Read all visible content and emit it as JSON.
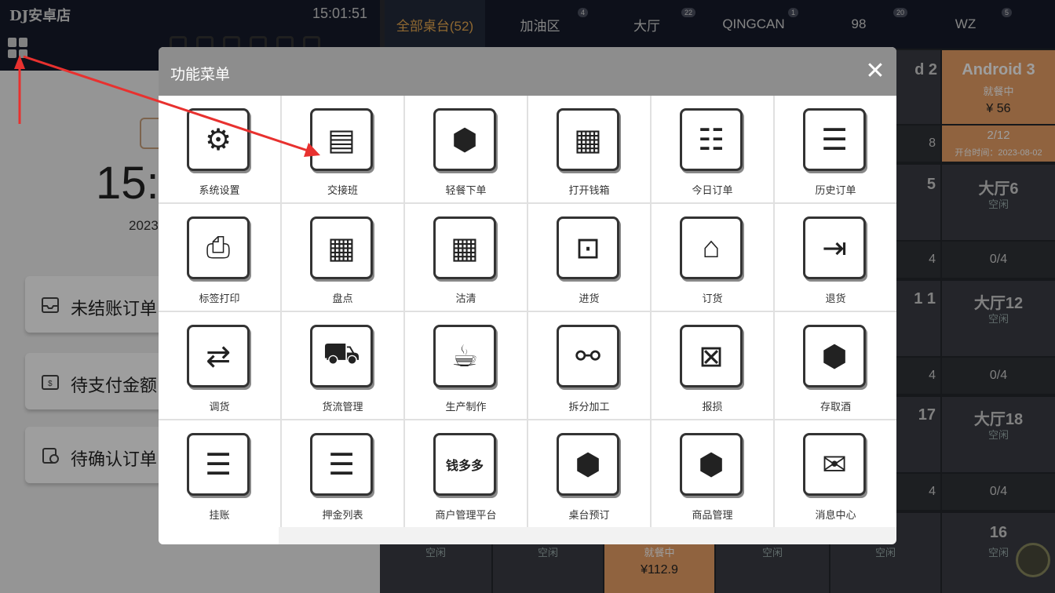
{
  "store_name": "DJ安卓店",
  "clock": "15:01:51",
  "big_time": "15:",
  "big_date": "2023",
  "tabs": [
    {
      "label": "全部桌台(52)",
      "count": ""
    },
    {
      "label": "加油区",
      "count": "4"
    },
    {
      "label": "大厅",
      "count": "22"
    },
    {
      "label": "QINGCAN",
      "count": "1"
    },
    {
      "label": "98",
      "count": "20"
    },
    {
      "label": "WZ",
      "count": "5"
    }
  ],
  "left_cards": [
    {
      "label": "未结账订单",
      "icon": "inbox-icon"
    },
    {
      "label": "待支付金额",
      "icon": "wallet-icon"
    },
    {
      "label": "待确认订单",
      "icon": "clipboard-check-icon"
    }
  ],
  "tables": {
    "partial_d2": "d 2",
    "partial_8": "8",
    "partial_5": "5",
    "partial_4a": "4",
    "partial_11": "1 1",
    "partial_4b": "4",
    "partial_17": "17",
    "partial_4c": "4",
    "android3": {
      "name": "Android 3",
      "status": "就餐中",
      "amount": "¥ 56",
      "guests": "2/12",
      "open_time": "开台时间：2023-08-02"
    },
    "hall6": {
      "name": "大厅6",
      "status": "空闲",
      "guests": "0/4"
    },
    "hall12": {
      "name": "大厅12",
      "status": "空闲",
      "guests": "0/4"
    },
    "hall18": {
      "name": "大厅18",
      "status": "空闲",
      "guests": "0/4"
    },
    "t16": {
      "name": "16",
      "status": "空闲"
    },
    "bottom_row": [
      "空闲",
      "空闲",
      "就餐中",
      "空闲",
      "空闲"
    ],
    "bottom_amount": "¥112.9"
  },
  "modal": {
    "title": "功能菜单",
    "close": "✕",
    "items": [
      {
        "label": "系统设置",
        "icon": "gear-icon",
        "glyph": "⚙"
      },
      {
        "label": "交接班",
        "icon": "id-card-icon",
        "glyph": "▤"
      },
      {
        "label": "轻餐下单",
        "icon": "boxes-icon",
        "glyph": "⬢"
      },
      {
        "label": "打开钱箱",
        "icon": "cash-register-icon",
        "glyph": "▦"
      },
      {
        "label": "今日订单",
        "icon": "clipboard-bell-icon",
        "glyph": "☷"
      },
      {
        "label": "历史订单",
        "icon": "clipboard-icon",
        "glyph": "☰"
      },
      {
        "label": "标签打印",
        "icon": "printer-icon",
        "glyph": "⎙"
      },
      {
        "label": "盘点",
        "icon": "calculator-icon",
        "glyph": "▦"
      },
      {
        "label": "沽清",
        "icon": "calculator-icon",
        "glyph": "▦"
      },
      {
        "label": "进货",
        "icon": "hand-truck-icon",
        "glyph": "⊡"
      },
      {
        "label": "订货",
        "icon": "store-box-icon",
        "glyph": "⌂"
      },
      {
        "label": "退货",
        "icon": "exit-box-icon",
        "glyph": "⇥"
      },
      {
        "label": "调货",
        "icon": "stores-transfer-icon",
        "glyph": "⇄"
      },
      {
        "label": "货流管理",
        "icon": "truck-icon",
        "glyph": "⛟"
      },
      {
        "label": "生产制作",
        "icon": "burger-drink-icon",
        "glyph": "☕"
      },
      {
        "label": "拆分加工",
        "icon": "broken-link-icon",
        "glyph": "⚯"
      },
      {
        "label": "报损",
        "icon": "box-trash-icon",
        "glyph": "⊠"
      },
      {
        "label": "存取酒",
        "icon": "boxes-icon",
        "glyph": "⬢"
      },
      {
        "label": "挂账",
        "icon": "clipboard-icon",
        "glyph": "☰"
      },
      {
        "label": "押金列表",
        "icon": "clipboard-icon",
        "glyph": "☰"
      },
      {
        "label": "商户管理平台",
        "icon": "qianduoduo-logo-icon",
        "glyph": "钱多多"
      },
      {
        "label": "桌台预订",
        "icon": "boxes-icon",
        "glyph": "⬢"
      },
      {
        "label": "商品管理",
        "icon": "boxes-icon",
        "glyph": "⬢"
      },
      {
        "label": "消息中心",
        "icon": "envelope-icon",
        "glyph": "✉"
      }
    ]
  },
  "colors": {
    "accent": "#e7a94f",
    "arrow": "#e8312f",
    "dark_bar": "#151b2a",
    "occupied": "#e9a066"
  }
}
